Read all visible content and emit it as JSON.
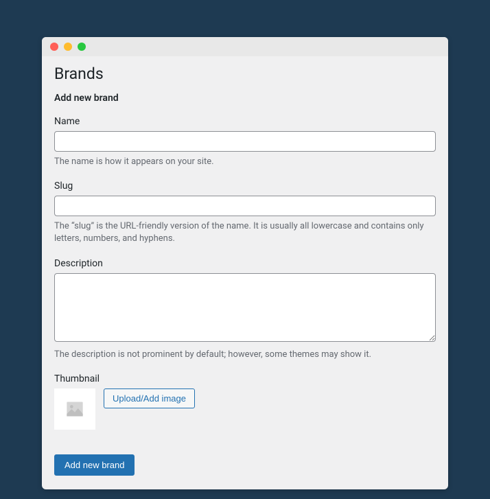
{
  "page": {
    "title": "Brands",
    "subtitle": "Add new brand"
  },
  "fields": {
    "name": {
      "label": "Name",
      "value": "",
      "help": "The name is how it appears on your site."
    },
    "slug": {
      "label": "Slug",
      "value": "",
      "help": "The “slug” is the URL-friendly version of the name. It is usually all lowercase and contains only letters, numbers, and hyphens."
    },
    "description": {
      "label": "Description",
      "value": "",
      "help": "The description is not prominent by default; however, some themes may show it."
    },
    "thumbnail": {
      "label": "Thumbnail",
      "upload_label": "Upload/Add image"
    }
  },
  "actions": {
    "submit": "Add new brand"
  }
}
